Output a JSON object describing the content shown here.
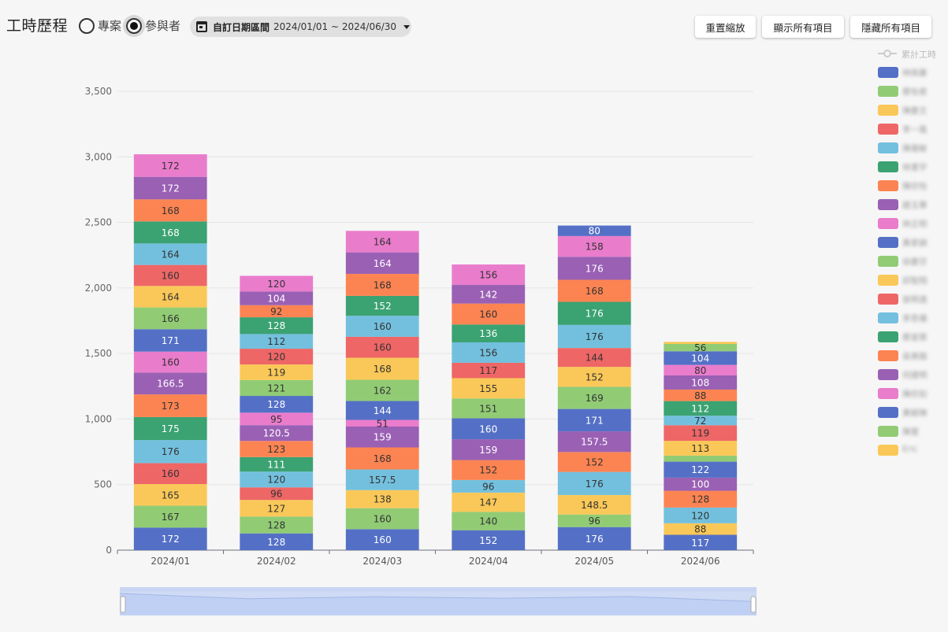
{
  "header": {
    "title": "工時歷程",
    "radio_options": [
      {
        "label": "專案",
        "checked": false
      },
      {
        "label": "參與者",
        "checked": true
      }
    ],
    "date_filter": {
      "label": "自訂日期區間",
      "range": "2024/01/01 ~ 2024/06/30",
      "icon": "calendar-icon"
    },
    "buttons": [
      {
        "label": "重置縮放",
        "icon": ""
      },
      {
        "label": "顯示所有項目",
        "icon": ""
      },
      {
        "label": "隱藏所有項目",
        "icon": ""
      }
    ]
  },
  "legend": {
    "line_item": "累計工時",
    "items": [
      {
        "name": "林佩蓁",
        "color": "#5470c6"
      },
      {
        "name": "蔡怡君",
        "color": "#91cc75"
      },
      {
        "name": "陳慶文",
        "color": "#fac858"
      },
      {
        "name": "李一風",
        "color": "#ee6666"
      },
      {
        "name": "陳雅敏",
        "color": "#73c0de"
      },
      {
        "name": "林書宇",
        "color": "#3ba272"
      },
      {
        "name": "陳欣怡",
        "color": "#fc8452"
      },
      {
        "name": "趙玉華",
        "color": "#9a60b4"
      },
      {
        "name": "林正明",
        "color": "#ea7ccc"
      },
      {
        "name": "黃家穎",
        "color": "#5470c6"
      },
      {
        "name": "徐慶芬",
        "color": "#91cc75"
      },
      {
        "name": "邱智翔",
        "color": "#fac858"
      },
      {
        "name": "張明遠",
        "color": "#ee6666"
      },
      {
        "name": "李思儀",
        "color": "#73c0de"
      },
      {
        "name": "蔡晉賢",
        "color": "#3ba272"
      },
      {
        "name": "吳美融",
        "color": "#fc8452"
      },
      {
        "name": "何建明",
        "color": "#9a60b4"
      },
      {
        "name": "陳欣如",
        "color": "#ea7ccc"
      },
      {
        "name": "黃毓琳",
        "color": "#5470c6"
      },
      {
        "name": "陳蕾",
        "color": "#91cc75"
      },
      {
        "name": "Eric",
        "color": "#fac858"
      }
    ]
  },
  "chart_data": {
    "type": "bar",
    "stacked": true,
    "categories": [
      "2024/01",
      "2024/02",
      "2024/03",
      "2024/04",
      "2024/05",
      "2024/06"
    ],
    "ylim": [
      0,
      3500
    ],
    "yticks": [
      0,
      500,
      1000,
      1500,
      2000,
      2500,
      3000,
      3500
    ],
    "ytick_labels": [
      "0",
      "500",
      "1,000",
      "1,500",
      "2,000",
      "2,500",
      "3,000",
      "3,500"
    ],
    "grid": true,
    "legend_position": "right",
    "series": [
      {
        "name": "林佩蓁",
        "color": "#5470c6",
        "values": [
          172,
          128,
          160,
          152,
          176,
          117
        ]
      },
      {
        "name": "蔡怡君",
        "color": "#91cc75",
        "values": [
          167,
          128,
          160,
          140,
          96,
          0
        ]
      },
      {
        "name": "陳慶文",
        "color": "#fac858",
        "values": [
          165,
          127,
          138,
          147,
          148.5,
          88
        ]
      },
      {
        "name": "李一風",
        "color": "#ee6666",
        "values": [
          160,
          96,
          0,
          0,
          0,
          0
        ]
      },
      {
        "name": "陳雅敏",
        "color": "#73c0de",
        "values": [
          176,
          120,
          157.5,
          96,
          176,
          120
        ]
      },
      {
        "name": "林書宇",
        "color": "#3ba272",
        "values": [
          175,
          111,
          0,
          0,
          0,
          0
        ]
      },
      {
        "name": "陳欣怡",
        "color": "#fc8452",
        "values": [
          173,
          123,
          168,
          152,
          152,
          128
        ]
      },
      {
        "name": "趙玉華",
        "color": "#9a60b4",
        "values": [
          166.5,
          120.5,
          159,
          159,
          157.5,
          100
        ]
      },
      {
        "name": "林正明",
        "color": "#ea7ccc",
        "values": [
          160,
          95,
          51,
          0,
          0,
          0
        ]
      },
      {
        "name": "黃家穎",
        "color": "#5470c6",
        "values": [
          171,
          128,
          144,
          160,
          171,
          122
        ]
      },
      {
        "name": "徐慶芬",
        "color": "#91cc75",
        "values": [
          166,
          121,
          162,
          151,
          169,
          46
        ]
      },
      {
        "name": "邱智翔",
        "color": "#fac858",
        "values": [
          164,
          119,
          168,
          155,
          152,
          113
        ]
      },
      {
        "name": "張明遠",
        "color": "#ee6666",
        "values": [
          160,
          120,
          160,
          117,
          144,
          119
        ]
      },
      {
        "name": "李思儀",
        "color": "#73c0de",
        "values": [
          164,
          112,
          160,
          156,
          176,
          72
        ]
      },
      {
        "name": "蔡晉賢",
        "color": "#3ba272",
        "values": [
          168,
          128,
          152,
          136,
          176,
          112
        ]
      },
      {
        "name": "吳美融",
        "color": "#fc8452",
        "values": [
          168,
          92,
          168,
          160,
          168,
          88
        ]
      },
      {
        "name": "何建明",
        "color": "#9a60b4",
        "values": [
          172,
          104,
          164,
          142,
          176,
          108
        ]
      },
      {
        "name": "陳欣如",
        "color": "#ea7ccc",
        "values": [
          172,
          120,
          164,
          156,
          158,
          80
        ]
      },
      {
        "name": "黃毓琳",
        "color": "#5470c6",
        "values": [
          0,
          0,
          0,
          0,
          80,
          104
        ]
      },
      {
        "name": "陳蕾",
        "color": "#91cc75",
        "values": [
          0,
          0,
          0,
          0,
          0,
          56
        ]
      },
      {
        "name": "Eric",
        "color": "#fac858",
        "values": [
          0,
          0,
          0,
          0,
          0,
          16
        ]
      }
    ],
    "cumulative_line": {
      "name": "累計工時",
      "hidden": true
    }
  },
  "data_zoom": {
    "start": 0,
    "end": 100
  }
}
